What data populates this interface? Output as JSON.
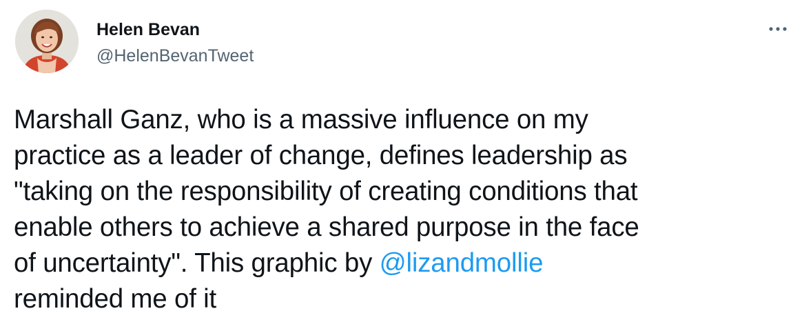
{
  "author": {
    "display_name": "Helen Bevan",
    "handle": "@HelenBevanTweet",
    "avatar_icon": "profile-photo"
  },
  "menu": {
    "icon": "more-options-icon"
  },
  "tweet": {
    "lines": [
      "Marshall Ganz, who is a massive influence on my",
      "practice as a leader of change, defines leadership as",
      "\"taking on the responsibility of creating conditions that",
      "enable others to achieve a shared purpose in the face",
      "of uncertainty\". This graphic by "
    ],
    "mention": "@lizandmollie",
    "last_line": "reminded me of it"
  },
  "colors": {
    "text": "#0f1419",
    "secondary": "#536471",
    "link": "#1d9bf0"
  }
}
